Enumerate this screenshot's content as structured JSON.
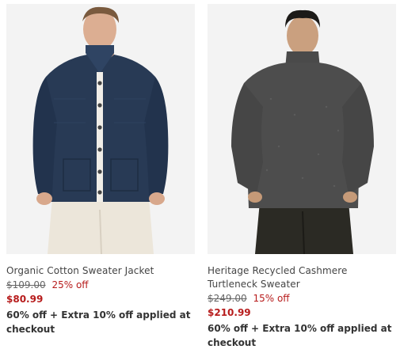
{
  "products": [
    {
      "name": "Organic Cotton Sweater Jacket",
      "original_price": "$109.00",
      "discount": "25% off",
      "sale_price": "$80.99",
      "promo": "60% off + Extra 10% off applied at checkout",
      "image": "navy-button-sweater-jacket"
    },
    {
      "name": "Heritage Recycled Cashmere Turtleneck Sweater",
      "original_price": "$249.00",
      "discount": "15% off",
      "sale_price": "$210.99",
      "promo": "60% off + Extra 10% off applied at checkout",
      "image": "charcoal-turtleneck-sweater"
    }
  ],
  "colors": {
    "sale": "#b71c1c",
    "text": "#333333",
    "image_bg": "#f4f4f4"
  }
}
